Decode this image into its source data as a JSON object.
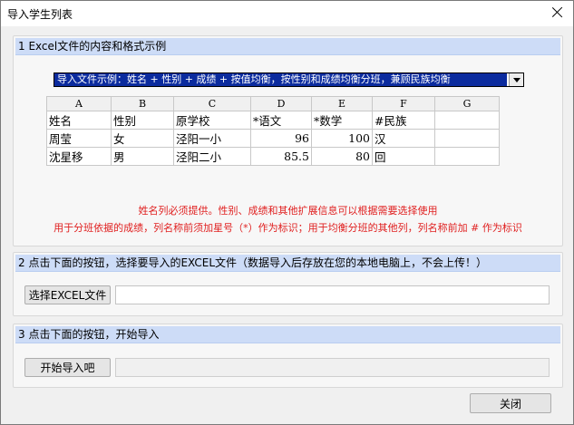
{
  "window": {
    "title": "导入学生列表",
    "close_button_label": "关闭"
  },
  "section1": {
    "header": "1 Excel文件的内容和格式示例",
    "dropdown_value": "导入文件示例：姓名 + 性别 + 成绩 + 按值均衡，按性别和成绩均衡分班，兼顾民族均衡",
    "column_letters": [
      "A",
      "B",
      "C",
      "D",
      "E",
      "F",
      "G"
    ],
    "rows": [
      [
        "姓名",
        "性别",
        "原学校",
        "*语文",
        "*数学",
        "#民族",
        ""
      ],
      [
        "周莹",
        "女",
        "泾阳一小",
        "96",
        "100",
        "汉",
        ""
      ],
      [
        "沈星移",
        "男",
        "泾阳二小",
        "85.5",
        "80",
        "回",
        ""
      ]
    ],
    "note1": "姓名列必须提供。性别、成绩和其他扩展信息可以根据需要选择使用",
    "note2": "用于分班依据的成绩，列名称前须加星号（*）作为标识；用于均衡分班的其他列，列名称前加 # 作为标识"
  },
  "section2": {
    "header": "2 点击下面的按钮，选择要导入的EXCEL文件（数据导入后存放在您的本地电脑上，不会上传！）",
    "select_button_label": "选择EXCEL文件",
    "file_path_value": ""
  },
  "section3": {
    "header": "3 点击下面的按钮，开始导入",
    "start_button_label": "开始导入吧",
    "progress_value": ""
  },
  "colors": {
    "header_bg": "#cddcf7",
    "dropdown_highlight": "#0b2b9e",
    "note_red": "#e02020"
  }
}
